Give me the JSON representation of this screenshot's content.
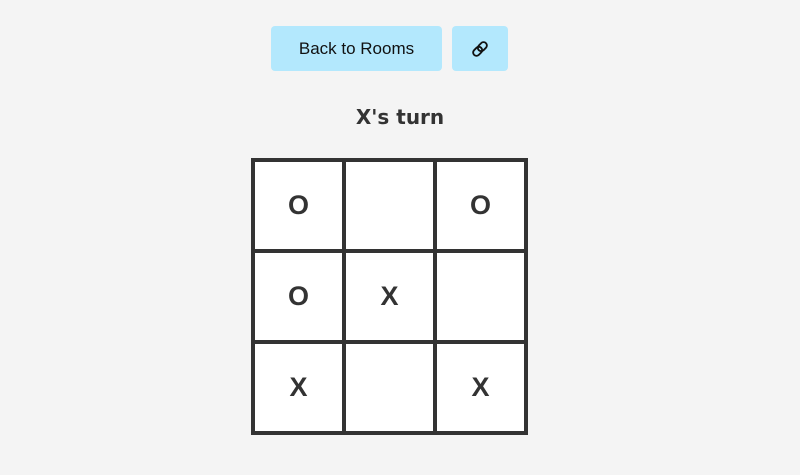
{
  "toolbar": {
    "back_label": "Back to Rooms",
    "link_icon": "link-icon"
  },
  "game": {
    "status": "X's turn",
    "board": [
      [
        "O",
        "",
        "O"
      ],
      [
        "O",
        "X",
        ""
      ],
      [
        "X",
        "",
        "X"
      ]
    ]
  },
  "colors": {
    "background": "#f4f4f4",
    "button": "#b3e8fd",
    "board_lines": "#333333",
    "cell": "#ffffff",
    "text": "#333333"
  }
}
